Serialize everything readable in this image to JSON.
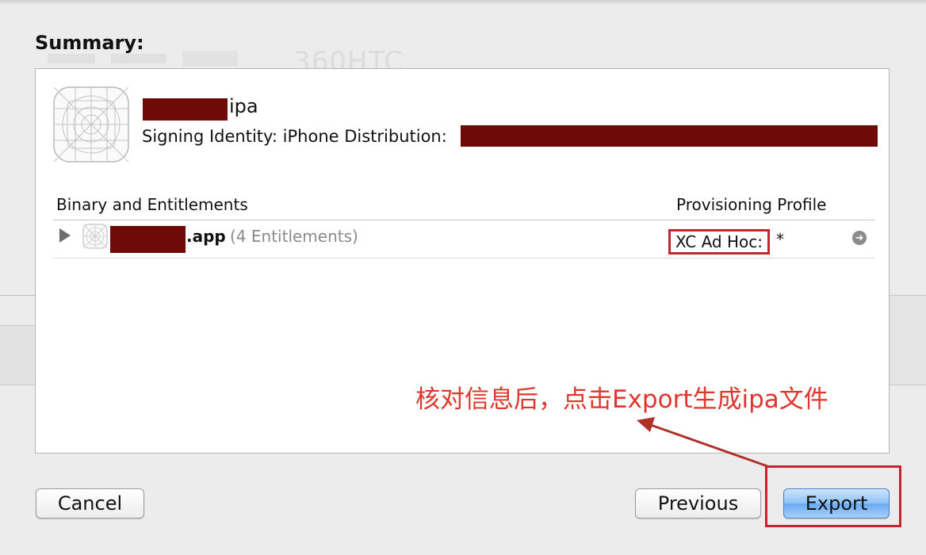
{
  "background": {
    "ghost_text": "360HTC"
  },
  "dialog": {
    "title": "Summary:",
    "ipa_name_suffix": "ipa",
    "signing_identity_label": "Signing Identity: iPhone Distribution:",
    "columns": {
      "binary": "Binary and Entitlements",
      "profile": "Provisioning Profile"
    },
    "rows": [
      {
        "app_name_suffix": ".app",
        "entitlements": "(4 Entitlements)",
        "profile": "XC Ad Hoc:",
        "profile_suffix": "*"
      }
    ],
    "annotation": "核对信息后，点击Export生成ipa文件"
  },
  "buttons": {
    "cancel": "Cancel",
    "previous": "Previous",
    "export": "Export"
  },
  "colors": {
    "redaction": "#6e0a08",
    "annotation": "#e0362c",
    "highlight": "#c0262d",
    "default_button": "#8cc0f5"
  },
  "icons": [
    "app-placeholder-icon",
    "disclosure-triangle-icon",
    "goto-arrow-icon"
  ]
}
